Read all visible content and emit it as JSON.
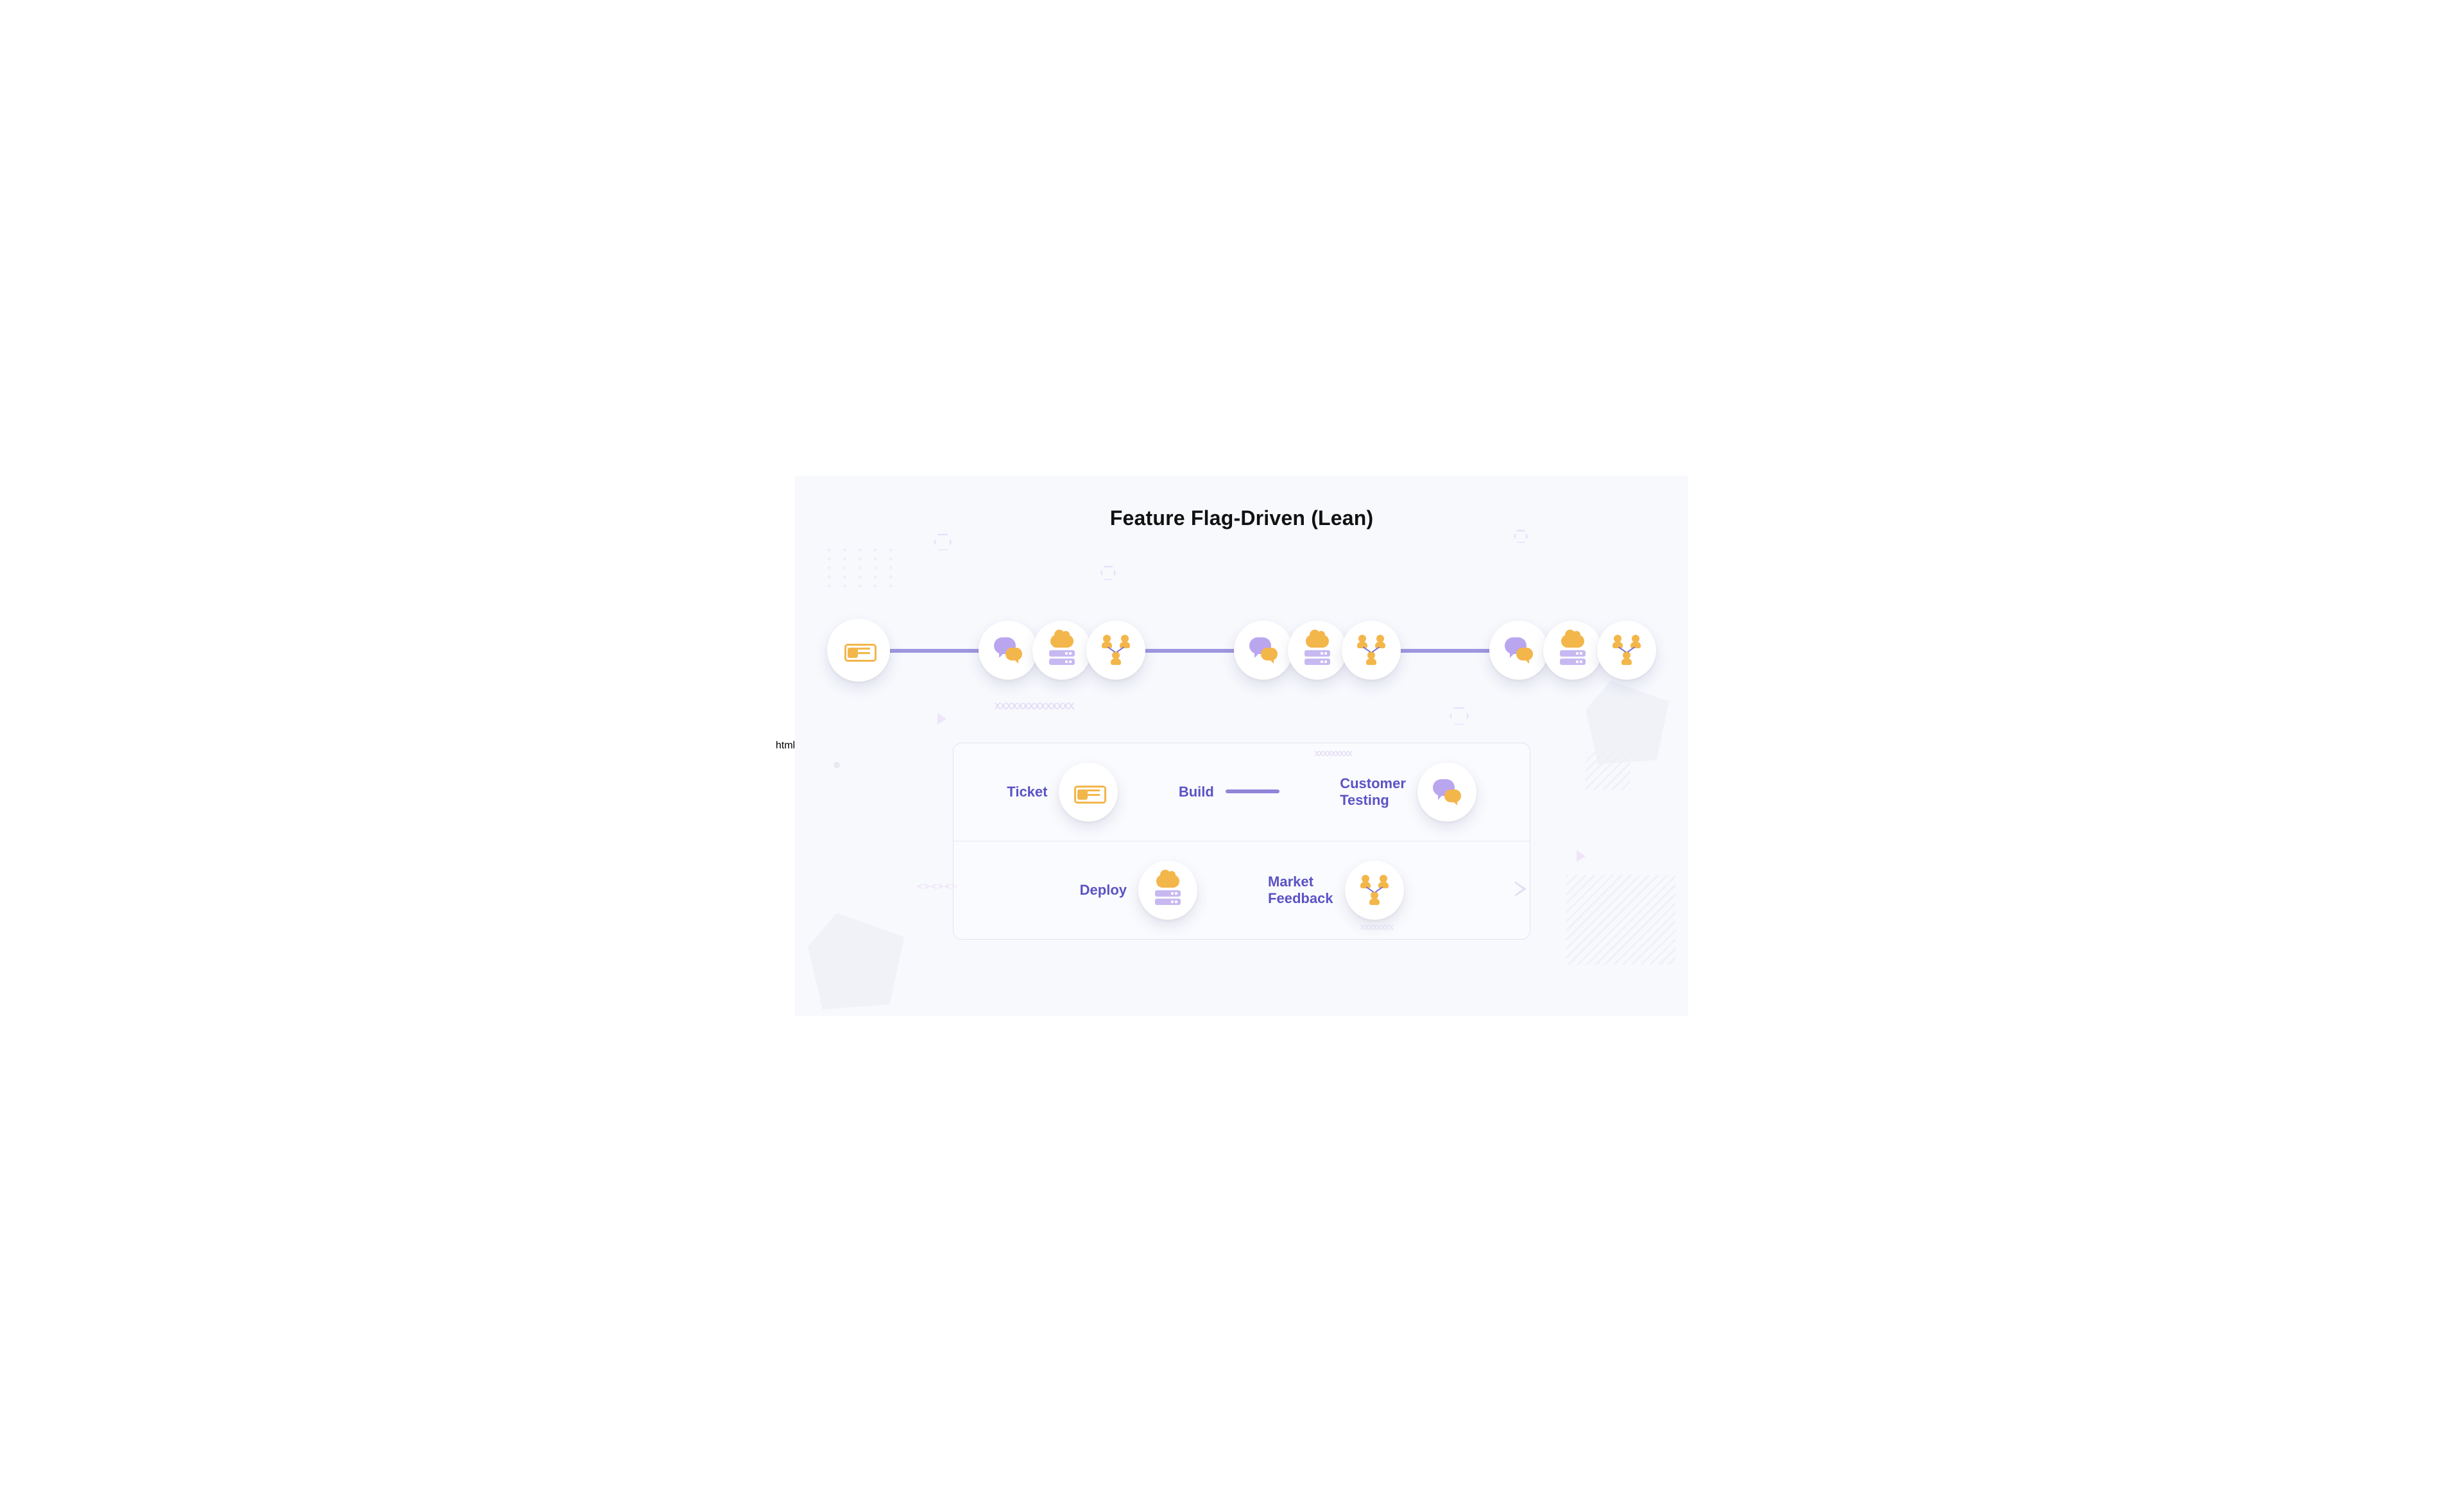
{
  "title": "Feature Flag-Driven (Lean)",
  "timeline": {
    "start_icon": "ticket-icon",
    "cycle_icons": [
      "chat-icon",
      "deploy-icon",
      "people-icon"
    ],
    "cycle_count": 3
  },
  "legend": {
    "row1": [
      {
        "label": "Ticket",
        "icon": "ticket-icon",
        "symbol": "circle"
      },
      {
        "label": "Build",
        "icon": null,
        "symbol": "line"
      },
      {
        "label": "Customer\nTesting",
        "icon": "chat-icon",
        "symbol": "circle",
        "has_squiggle": true
      }
    ],
    "row2": [
      {
        "label": "Deploy",
        "icon": "deploy-icon",
        "symbol": "circle"
      },
      {
        "label": "Market\nFeedback",
        "icon": "people-icon",
        "symbol": "circle"
      }
    ]
  },
  "colors": {
    "accent_purple": "#8f86d9",
    "accent_orange": "#f3b64a",
    "accent_lilac": "#c8b8f2",
    "text_purple": "#5b52c5",
    "bg": "#f7f9fd"
  }
}
